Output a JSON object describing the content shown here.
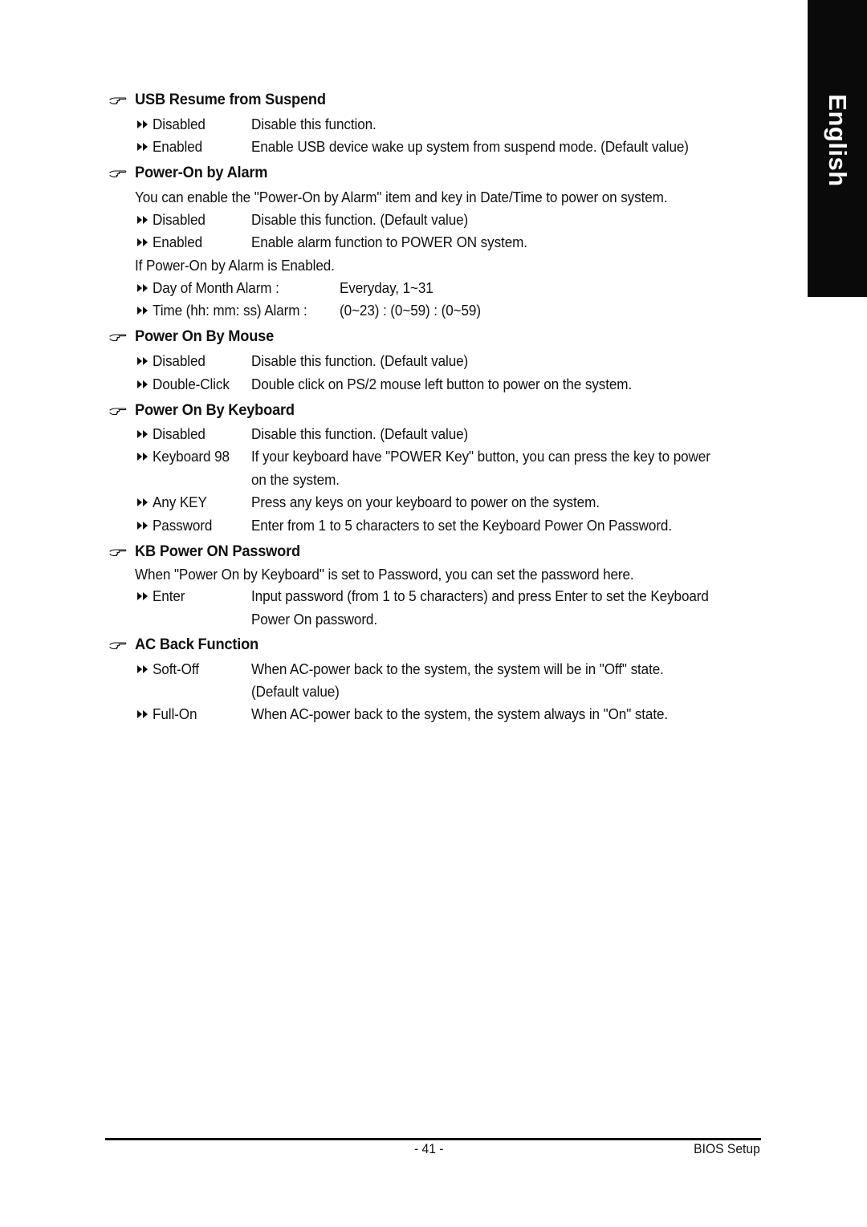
{
  "side_tab": {
    "label": "English",
    "background": "#0a0a0a",
    "text_color": "#ffffff"
  },
  "icons": {
    "heading": "pointing-hand-icon",
    "option": "double-arrow-icon"
  },
  "sections": {
    "usb": {
      "title": "USB Resume from Suspend",
      "options": [
        {
          "name": "Disabled",
          "desc": "Disable this function."
        },
        {
          "name": "Enabled",
          "desc": "Enable USB device wake up system from suspend mode. (Default value)"
        }
      ]
    },
    "alarm": {
      "title": "Power-On by Alarm",
      "intro": "You can enable the \"Power-On by Alarm\" item and key in Date/Time to power on system.",
      "options": [
        {
          "name": "Disabled",
          "desc": "Disable this function. (Default value)"
        },
        {
          "name": "Enabled",
          "desc": "Enable alarm function to POWER ON system."
        }
      ],
      "condition": "If Power-On by Alarm is Enabled.",
      "settings": [
        {
          "name": "Day of Month Alarm :",
          "value": "Everyday, 1~31"
        },
        {
          "name": "Time (hh: mm: ss) Alarm :",
          "value": "(0~23) : (0~59) : (0~59)"
        }
      ]
    },
    "mouse": {
      "title": "Power On By Mouse",
      "options": [
        {
          "name": "Disabled",
          "desc": "Disable this function. (Default value)"
        },
        {
          "name": "Double-Click",
          "desc": "Double click on PS/2 mouse left button to power on the system."
        }
      ]
    },
    "keyboard": {
      "title": "Power On By Keyboard",
      "options": [
        {
          "name": "Disabled",
          "desc": "Disable this function. (Default value)"
        },
        {
          "name": "Keyboard 98",
          "desc": "If your keyboard have \"POWER Key\" button, you can press the key to power",
          "desc_cont": "on the system."
        },
        {
          "name": "Any KEY",
          "desc": "Press any keys on your keyboard to power on the system."
        },
        {
          "name": "Password",
          "desc": "Enter from 1 to 5 characters to set the Keyboard Power On Password."
        }
      ]
    },
    "kbpass": {
      "title": "KB Power ON Password",
      "intro": "When \"Power On by Keyboard\" is set to Password, you can set the password here.",
      "options": [
        {
          "name": "Enter",
          "desc": "Input password (from 1 to 5 characters) and press Enter to set the Keyboard",
          "desc_cont": "Power On password."
        }
      ]
    },
    "acback": {
      "title": "AC Back Function",
      "options": [
        {
          "name": "Soft-Off",
          "desc": "When AC-power back to the system, the system will be in \"Off\" state.",
          "desc_cont": "(Default value)"
        },
        {
          "name": "Full-On",
          "desc": "When AC-power back to the system, the system always in \"On\" state."
        }
      ]
    }
  },
  "footer": {
    "page_number": "- 41 -",
    "title": "BIOS Setup"
  }
}
